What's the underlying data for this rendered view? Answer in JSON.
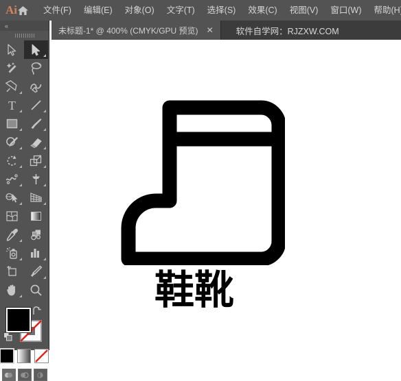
{
  "app": {
    "logo_text": "Ai",
    "home_icon": "home-icon"
  },
  "menubar": {
    "items": [
      {
        "label": "文件(F)",
        "name": "menu-file"
      },
      {
        "label": "编辑(E)",
        "name": "menu-edit"
      },
      {
        "label": "对象(O)",
        "name": "menu-object"
      },
      {
        "label": "文字(T)",
        "name": "menu-type"
      },
      {
        "label": "选择(S)",
        "name": "menu-select"
      },
      {
        "label": "效果(C)",
        "name": "menu-effect"
      },
      {
        "label": "视图(V)",
        "name": "menu-view"
      },
      {
        "label": "窗口(W)",
        "name": "menu-window"
      },
      {
        "label": "帮助(H)",
        "name": "menu-help"
      }
    ]
  },
  "tabbar": {
    "document_tab": {
      "title": "未标题-1* @ 400% (CMYK/GPU 预览)",
      "close_label": "✕"
    },
    "site_label": "软件自学网：RJZXW.COM"
  },
  "toolbar": {
    "collapse_label": "«",
    "tools": [
      {
        "name": "selection-tool",
        "icon": "arrow-cursor-icon",
        "active": false,
        "corner": false
      },
      {
        "name": "direct-selection-tool",
        "icon": "solid-arrow-cursor-icon",
        "active": true,
        "corner": true
      },
      {
        "name": "magic-wand-tool",
        "icon": "magic-wand-icon",
        "active": false,
        "corner": false
      },
      {
        "name": "lasso-tool",
        "icon": "lasso-icon",
        "active": false,
        "corner": false
      },
      {
        "name": "pen-tool",
        "icon": "pen-nib-icon",
        "active": false,
        "corner": true
      },
      {
        "name": "curvature-tool",
        "icon": "curvature-pen-icon",
        "active": false,
        "corner": false
      },
      {
        "name": "type-tool",
        "icon": "type-T-icon",
        "active": false,
        "corner": true
      },
      {
        "name": "line-segment-tool",
        "icon": "line-segment-icon",
        "active": false,
        "corner": true
      },
      {
        "name": "rectangle-tool",
        "icon": "rectangle-icon",
        "active": false,
        "corner": true
      },
      {
        "name": "paintbrush-tool",
        "icon": "paintbrush-icon",
        "active": false,
        "corner": true
      },
      {
        "name": "shaper-tool",
        "icon": "shaper-pencil-icon",
        "active": false,
        "corner": true
      },
      {
        "name": "eraser-tool",
        "icon": "eraser-icon",
        "active": false,
        "corner": true
      },
      {
        "name": "rotate-tool",
        "icon": "rotate-icon",
        "active": false,
        "corner": true
      },
      {
        "name": "scale-tool",
        "icon": "scale-icon",
        "active": false,
        "corner": true
      },
      {
        "name": "width-tool",
        "icon": "width-warp-icon",
        "active": false,
        "corner": true
      },
      {
        "name": "free-transform-tool",
        "icon": "pushpin-icon",
        "active": false,
        "corner": true
      },
      {
        "name": "shape-builder-tool",
        "icon": "shape-builder-icon",
        "active": false,
        "corner": true
      },
      {
        "name": "perspective-grid-tool",
        "icon": "perspective-grid-icon",
        "active": false,
        "corner": true
      },
      {
        "name": "mesh-tool",
        "icon": "mesh-icon",
        "active": false,
        "corner": false
      },
      {
        "name": "gradient-tool",
        "icon": "gradient-icon",
        "active": false,
        "corner": false
      },
      {
        "name": "eyedropper-tool",
        "icon": "eyedropper-icon",
        "active": false,
        "corner": true
      },
      {
        "name": "blend-tool",
        "icon": "blend-icon",
        "active": false,
        "corner": false
      },
      {
        "name": "symbol-sprayer-tool",
        "icon": "symbol-sprayer-icon",
        "active": false,
        "corner": true
      },
      {
        "name": "column-graph-tool",
        "icon": "bar-chart-icon",
        "active": false,
        "corner": true
      },
      {
        "name": "artboard-tool",
        "icon": "artboard-icon",
        "active": false,
        "corner": false
      },
      {
        "name": "slice-tool",
        "icon": "slice-knife-icon",
        "active": false,
        "corner": true
      },
      {
        "name": "hand-tool",
        "icon": "hand-icon",
        "active": false,
        "corner": true
      },
      {
        "name": "zoom-tool",
        "icon": "magnifier-icon",
        "active": false,
        "corner": false
      }
    ],
    "colors": {
      "fill": "#000000",
      "stroke": "#ffffff",
      "none_slash": "#e32119",
      "swap_icon": "swap-fill-stroke-icon",
      "default_icon": "default-fill-stroke-icon"
    },
    "mini_swatches": [
      {
        "name": "color-swatch",
        "mode": "solid",
        "selected": true
      },
      {
        "name": "gradient-swatch",
        "mode": "grad",
        "selected": false
      },
      {
        "name": "none-swatch",
        "mode": "none",
        "selected": false
      }
    ],
    "draw_modes": [
      {
        "name": "draw-normal-mode",
        "active": true
      },
      {
        "name": "draw-behind-mode",
        "active": false
      },
      {
        "name": "draw-inside-mode",
        "active": false
      }
    ]
  },
  "canvas": {
    "artwork_name": "boot-shoe-outline-artwork",
    "caption": "鞋靴"
  }
}
